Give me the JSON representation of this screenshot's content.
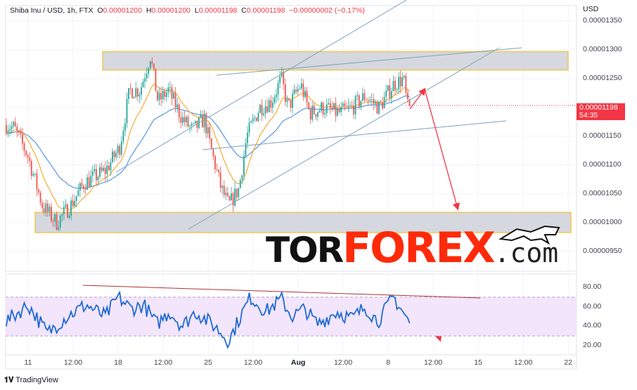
{
  "legend": {
    "symbol": "Shiba Inu / USD, 1h, FTX",
    "o_label": "O",
    "o": "0.00001200",
    "h_label": "H",
    "h": "0.00001200",
    "l_label": "L",
    "l": "0.00001198",
    "c_label": "C",
    "c": "0.00001198",
    "change": "−0.00000002 (−0.17%)"
  },
  "currency": "USD",
  "last_price": {
    "value": "0.00001198",
    "countdown": "54:35"
  },
  "brand": {
    "tor": "TOR",
    "forex": "FOREX",
    "com": ".com",
    "footer": "TradingView"
  },
  "colors": {
    "up": "#26a69a",
    "down": "#ef5350",
    "ma_fast": "#f5a623",
    "ma_slow": "#4a90e2",
    "rsi": "#1e6bd6",
    "zone": "#f0c040",
    "arrow": "#f23645"
  },
  "chart_data": {
    "type": "candlestick",
    "title": "Shiba Inu / USD, 1h, FTX",
    "ylabel": "USD",
    "ylim": [
      9.2e-06,
      1.37e-05
    ],
    "y_ticks": [
      "0.00001350",
      "0.00001300",
      "0.00001250",
      "0.00001150",
      "0.00001100",
      "0.00001050",
      "0.00001000",
      "0.00000950"
    ],
    "x_ticks": [
      "11",
      "12:00",
      "18",
      "12:00",
      "25",
      "12:00",
      "Aug",
      "12:00",
      "8",
      "12:00",
      "15",
      "12:00",
      "22"
    ],
    "price_path_units": "day offset from Jul 11, price x1e-8 USD",
    "price_path": [
      [
        -1.7,
        1170
      ],
      [
        -1.1,
        1165
      ],
      [
        0,
        1115
      ],
      [
        1.1,
        1030
      ],
      [
        2.2,
        1000
      ],
      [
        3.3,
        1030
      ],
      [
        4.4,
        1070
      ],
      [
        6,
        1090
      ],
      [
        7.1,
        1130
      ],
      [
        7.9,
        1230
      ],
      [
        8.7,
        1230
      ],
      [
        9.5,
        1290
      ],
      [
        10.1,
        1210
      ],
      [
        10.9,
        1230
      ],
      [
        12,
        1180
      ],
      [
        12.8,
        1160
      ],
      [
        13.7,
        1180
      ],
      [
        14.2,
        1130
      ],
      [
        15,
        1060
      ],
      [
        15.6,
        1030
      ],
      [
        16.4,
        1060
      ],
      [
        17,
        1150
      ],
      [
        18,
        1200
      ],
      [
        18.9,
        1210
      ],
      [
        19.7,
        1250
      ],
      [
        20.2,
        1200
      ],
      [
        21.2,
        1240
      ],
      [
        21.9,
        1190
      ],
      [
        23,
        1200
      ],
      [
        24.1,
        1190
      ],
      [
        25.2,
        1200
      ],
      [
        26.2,
        1220
      ],
      [
        27.3,
        1200
      ],
      [
        28.4,
        1240
      ],
      [
        29.2,
        1250
      ],
      [
        29.5,
        1200
      ],
      [
        29.8,
        1198
      ]
    ],
    "zones": [
      {
        "name": "resistance",
        "from": 1265,
        "to": 1297
      },
      {
        "name": "support",
        "from": 983,
        "to": 1018
      }
    ],
    "rsi": {
      "ylim": [
        10,
        92
      ],
      "ticks": [
        "80.00",
        "60.00",
        "40.00",
        "20.00"
      ],
      "band": [
        30,
        70
      ],
      "path": [
        [
          -1.7,
          45
        ],
        [
          0,
          62
        ],
        [
          1.5,
          33
        ],
        [
          3,
          50
        ],
        [
          4.5,
          62
        ],
        [
          6,
          50
        ],
        [
          7,
          70
        ],
        [
          8,
          58
        ],
        [
          9,
          62
        ],
        [
          10,
          42
        ],
        [
          11,
          55
        ],
        [
          12,
          40
        ],
        [
          13,
          55
        ],
        [
          14.5,
          40
        ],
        [
          15.6,
          25
        ],
        [
          16.5,
          50
        ],
        [
          17.3,
          70
        ],
        [
          18.5,
          55
        ],
        [
          19.7,
          68
        ],
        [
          20.5,
          50
        ],
        [
          21.5,
          58
        ],
        [
          22.5,
          42
        ],
        [
          24,
          55
        ],
        [
          25.2,
          48
        ],
        [
          26.2,
          60
        ],
        [
          27.2,
          45
        ],
        [
          28.4,
          70
        ],
        [
          29,
          58
        ],
        [
          29.8,
          40
        ]
      ]
    }
  }
}
